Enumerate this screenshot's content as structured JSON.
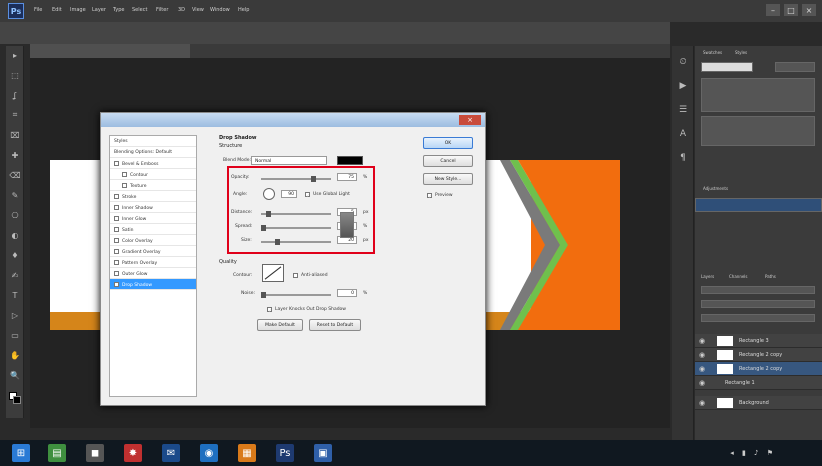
{
  "app": {
    "logo_text": "Ps",
    "menu_items": [
      "File",
      "Edit",
      "Image",
      "Layer",
      "Type",
      "Select",
      "Filter",
      "3D",
      "View",
      "Window",
      "Help"
    ],
    "window_controls": [
      "–",
      "□",
      "×"
    ],
    "options_bar_text": "",
    "doc_tab_label": "",
    "tool_glyphs": [
      "▸",
      "⬚",
      "ʆ",
      "⌗",
      "⌧",
      "✚",
      "⌫",
      "✎",
      "⎔",
      "◐",
      "♦",
      "✍",
      "T",
      "▷",
      "▭",
      "✋",
      "🔍"
    ]
  },
  "dialog": {
    "title": "",
    "close_glyph": "×",
    "styles": [
      {
        "label": "Styles",
        "checkbox": false,
        "selected": false
      },
      {
        "label": "Blending Options: Default",
        "checkbox": false,
        "selected": false
      },
      {
        "label": "Bevel & Emboss",
        "checkbox": true,
        "selected": false
      },
      {
        "label": "Contour",
        "checkbox": true,
        "selected": false
      },
      {
        "label": "Texture",
        "checkbox": true,
        "selected": false
      },
      {
        "label": "Stroke",
        "checkbox": true,
        "selected": false
      },
      {
        "label": "Inner Shadow",
        "checkbox": true,
        "selected": false
      },
      {
        "label": "Inner Glow",
        "checkbox": true,
        "selected": false
      },
      {
        "label": "Satin",
        "checkbox": true,
        "selected": false
      },
      {
        "label": "Color Overlay",
        "checkbox": true,
        "selected": false
      },
      {
        "label": "Gradient Overlay",
        "checkbox": true,
        "selected": false
      },
      {
        "label": "Pattern Overlay",
        "checkbox": true,
        "selected": false
      },
      {
        "label": "Outer Glow",
        "checkbox": true,
        "selected": false
      },
      {
        "label": "Drop Shadow",
        "checkbox": true,
        "selected": true
      }
    ],
    "section_title": "Drop Shadow",
    "structure_label": "Structure",
    "blend_mode_label": "Blend Mode:",
    "blend_mode_value": "Normal",
    "opacity_label": "Opacity:",
    "opacity_value": "75",
    "angle_label": "Angle:",
    "angle_value": "90",
    "global_light_label": "Use Global Light",
    "distance_label": "Distance:",
    "distance_value": "5",
    "spread_label": "Spread:",
    "spread_value": "0",
    "size_label": "Size:",
    "size_value": "20",
    "percent_unit": "%",
    "px_unit": "px",
    "quality_label": "Quality",
    "contour_label": "Contour:",
    "anti_aliased_label": "Anti-aliased",
    "noise_label": "Noise:",
    "noise_value": "0",
    "knocks_out_label": "Layer Knocks Out Drop Shadow",
    "make_default_label": "Make Default",
    "reset_default_label": "Reset to Default",
    "ok_label": "OK",
    "cancel_label": "Cancel",
    "new_style_label": "New Style...",
    "preview_label": "Preview"
  },
  "right_panel": {
    "tabs": [
      "Swatches",
      "Styles"
    ],
    "adj_tabs": [
      "Adjustments"
    ],
    "layers_tabs": [
      "Layers",
      "Channels",
      "Paths"
    ],
    "layer_rows": [
      "Rectangle 3",
      "Rectangle 2 copy",
      "Rectangle 2 copy",
      "Rectangle 1",
      "Background"
    ],
    "selected_layer_index": 2
  },
  "taskbar": {
    "icons": [
      {
        "glyph": "⊞",
        "color": "#2a7ad5"
      },
      {
        "glyph": "▤",
        "color": "#3f8f3f"
      },
      {
        "glyph": "◼",
        "color": "#555"
      },
      {
        "glyph": "✸",
        "color": "#c03030"
      },
      {
        "glyph": "✉",
        "color": "#1b4a8a"
      },
      {
        "glyph": "◉",
        "color": "#1e6fc0"
      },
      {
        "glyph": "▦",
        "color": "#d97a1a"
      },
      {
        "glyph": "Ps",
        "color": "#1e3a70"
      },
      {
        "glyph": "▣",
        "color": "#2f5fa8"
      }
    ],
    "tray": "◂ ▮ ♪ ⚑",
    "clock_time": "",
    "clock_date": ""
  },
  "colors": {
    "accent_orange": "#f26d0e",
    "chevron_green": "#6fc04d",
    "chevron_gray": "#7a7a7a",
    "highlight_red": "#e0001a",
    "selection_blue": "#3399ff"
  }
}
